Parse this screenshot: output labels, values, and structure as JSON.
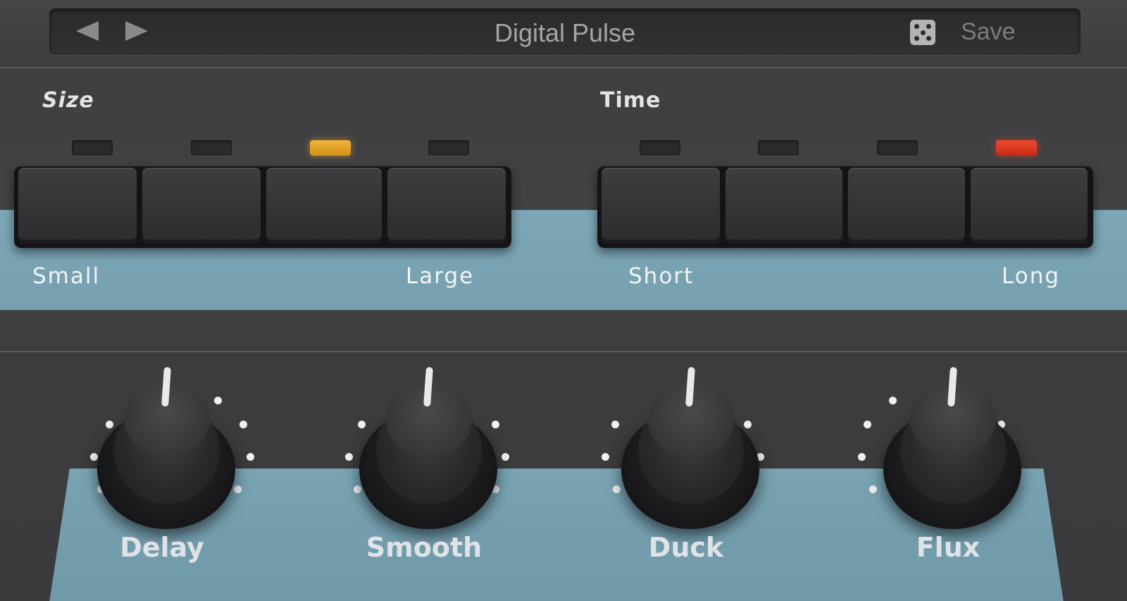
{
  "preset": {
    "name": "Digital Pulse",
    "save_label": "Save",
    "prev_icon": "arrow-left-icon",
    "next_icon": "arrow-right-icon",
    "random_icon": "dice-icon"
  },
  "size": {
    "label": "Size",
    "min_label": "Small",
    "max_label": "Large",
    "steps": 4,
    "selected_index": 2,
    "led_color": "#e8a82a"
  },
  "time": {
    "label": "Time",
    "min_label": "Short",
    "max_label": "Long",
    "steps": 4,
    "selected_index": 3,
    "led_color": "#e2412a"
  },
  "knobs": [
    {
      "label": "Delay"
    },
    {
      "label": "Smooth"
    },
    {
      "label": "Duck"
    },
    {
      "label": "Flux"
    }
  ],
  "colors": {
    "panel_blue": "#79a3b3",
    "body": "#3d3d3f"
  }
}
